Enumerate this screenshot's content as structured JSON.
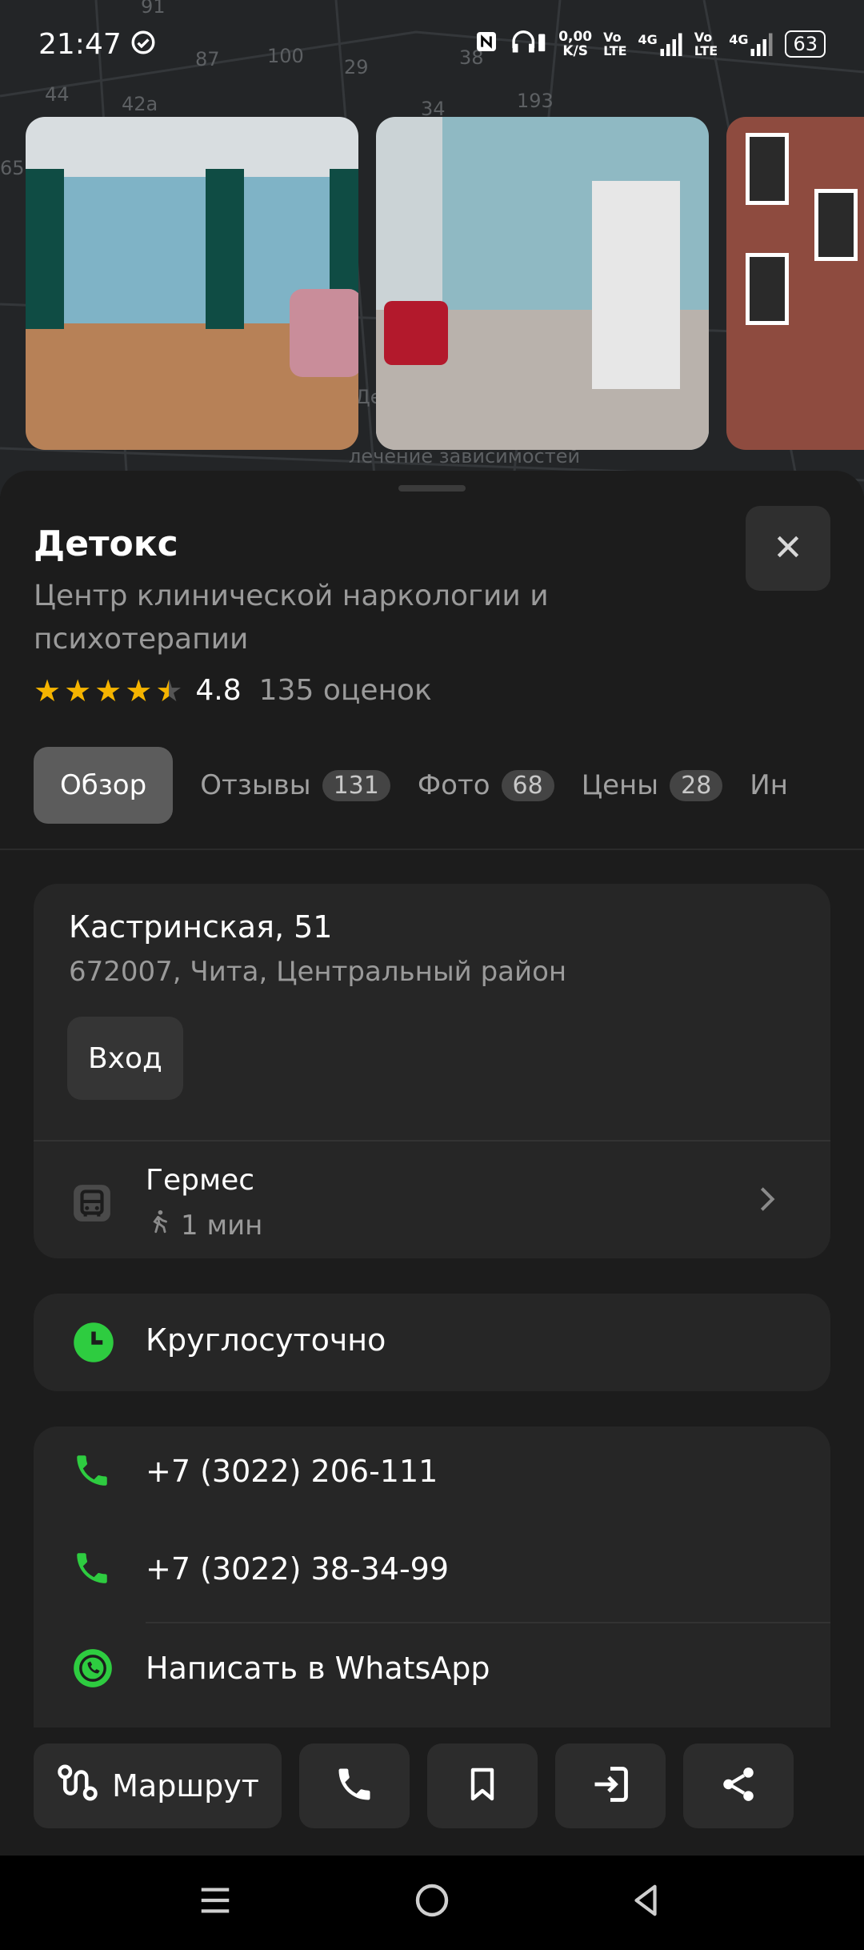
{
  "status_bar": {
    "time": "21:47",
    "net_speed": "0,00\nK/S",
    "net_speed_top": "0,00",
    "net_speed_bottom": "K/S",
    "volte1": "Vo\nLTE",
    "sig1": "4G",
    "volte2": "Vo\nLTE",
    "sig2": "4G",
    "battery": "63"
  },
  "map": {
    "labels": [
      "91",
      "87",
      "100",
      "29",
      "38",
      "44",
      "42a",
      "34",
      "193",
      "65",
      "Де",
      "лечение зависимостей"
    ]
  },
  "place": {
    "title": "Детокс",
    "subtitle": "Центр клинической наркологии и психотерапии",
    "rating_value": "4.8",
    "rating_stars": 4.5,
    "rating_count": "135 оценок"
  },
  "tabs": [
    {
      "label": "Обзор",
      "badge": ""
    },
    {
      "label": "Отзывы",
      "badge": "131"
    },
    {
      "label": "Фото",
      "badge": "68"
    },
    {
      "label": "Цены",
      "badge": "28"
    },
    {
      "label": "Ин",
      "badge": ""
    }
  ],
  "address": {
    "street": "Кастринская, 51",
    "details": "672007, Чита, Центральный район",
    "entrance_label": "Вход",
    "transit_stop": "Гермес",
    "walk_time": "1 мин"
  },
  "hours": {
    "text": "Круглосуточно"
  },
  "contacts": {
    "phone1": "+7 (3022) 206-111",
    "phone2": "+7 (3022) 38-34-99",
    "whatsapp": "Написать в WhatsApp"
  },
  "actions": {
    "route_label": "Маршрут"
  },
  "colors": {
    "accent_green": "#2ecc40",
    "star": "#f5b400",
    "sheet_bg": "#1c1c1c",
    "card_bg": "#262626"
  },
  "icons": [
    "check-circle-icon",
    "nfc-icon",
    "headphones-icon",
    "close-icon",
    "bus-icon",
    "walk-icon",
    "chevron-right-icon",
    "clock-icon",
    "phone-icon",
    "whatsapp-icon",
    "route-icon",
    "bookmark-icon",
    "entry-icon",
    "share-icon",
    "menu-icon",
    "home-icon",
    "back-icon"
  ]
}
